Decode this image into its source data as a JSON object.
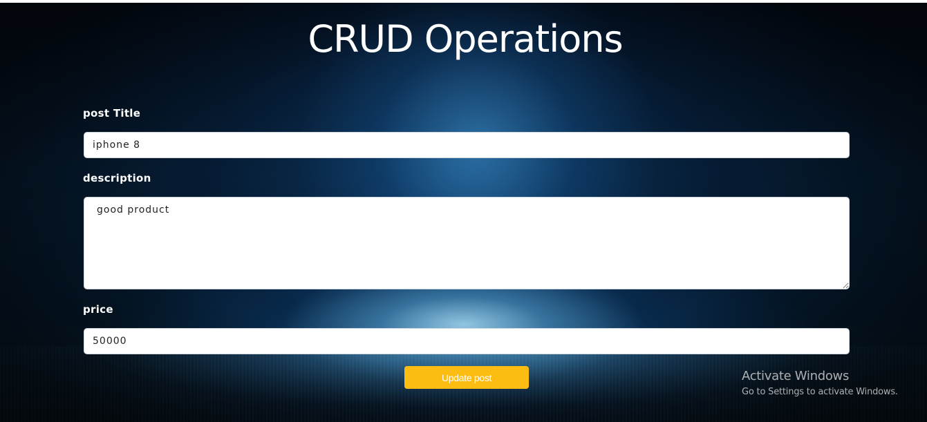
{
  "page": {
    "title": "CRUD Operations"
  },
  "form": {
    "title_field": {
      "label": "post Title",
      "value": "iphone 8"
    },
    "description_field": {
      "label": "description",
      "value": "good product"
    },
    "price_field": {
      "label": "price",
      "value": "50000"
    },
    "submit_label": "Update post"
  },
  "watermark": {
    "title": "Activate Windows",
    "subtitle": "Go to Settings to activate Windows."
  },
  "colors": {
    "button_bg": "#fcbc12",
    "button_text": "#ffffff",
    "label_text": "#ffffff",
    "background_accent": "#3aa0e0"
  }
}
